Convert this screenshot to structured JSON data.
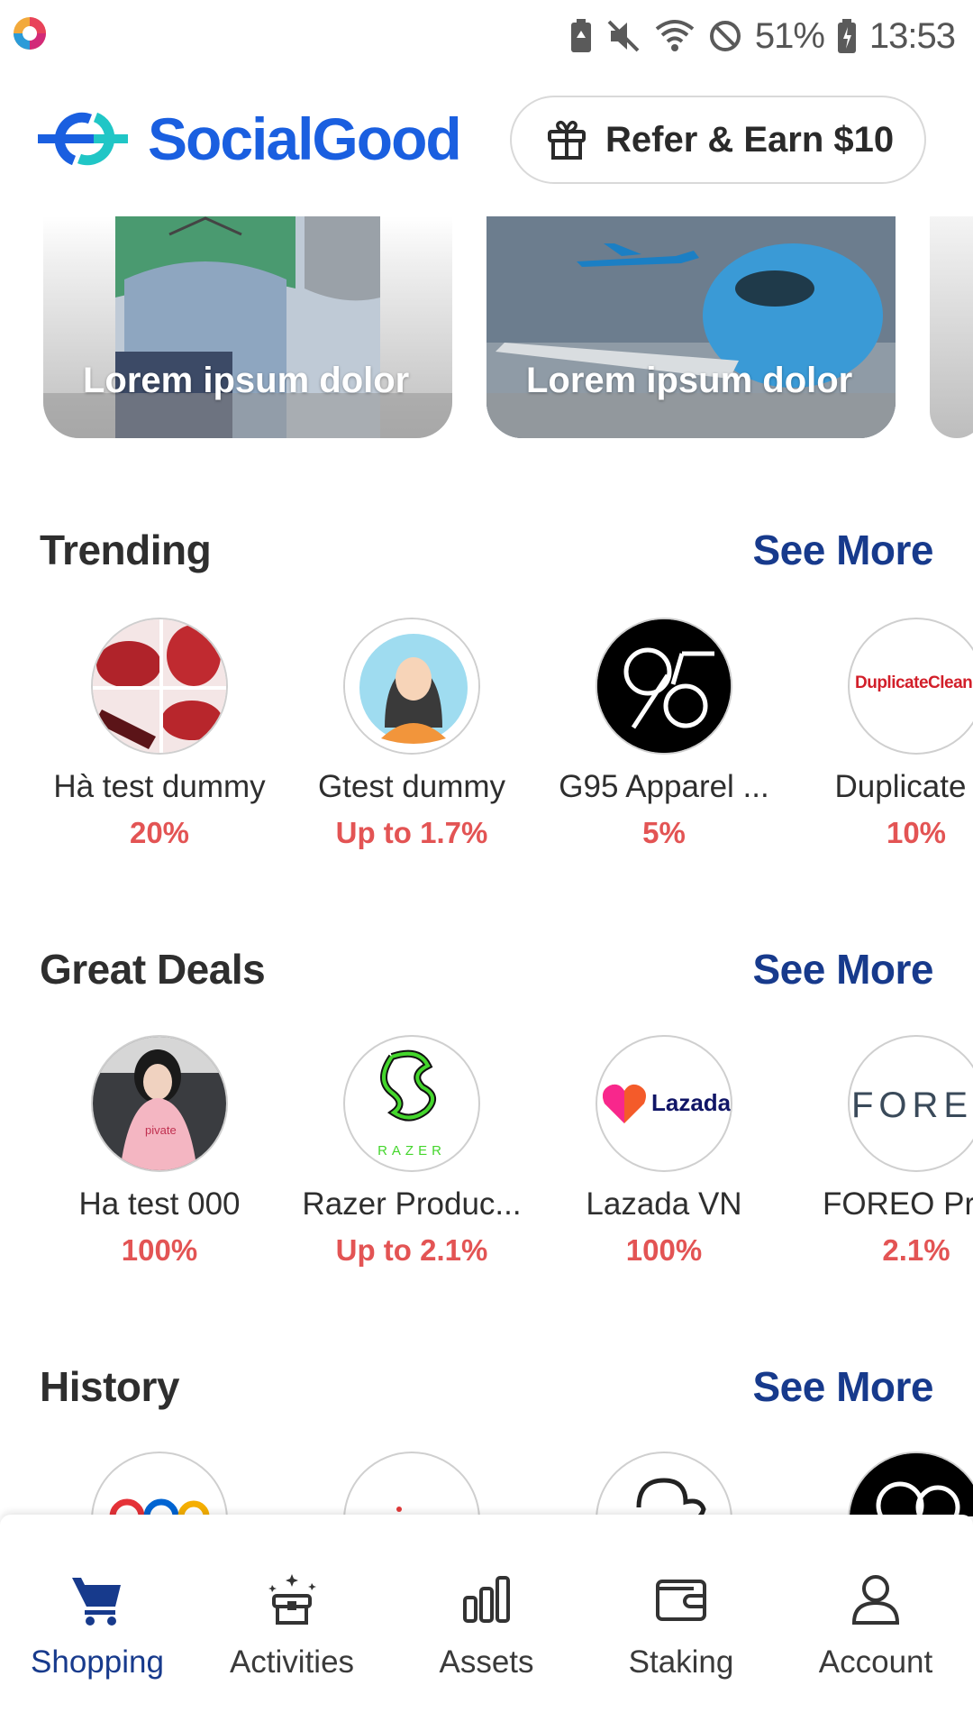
{
  "status_bar": {
    "battery": "51%",
    "time": "13:53"
  },
  "header": {
    "brand": "SocialGood",
    "refer_label": "Refer & Earn $10"
  },
  "banners": [
    {
      "title": "Lorem ipsum dolor"
    },
    {
      "title": "Lorem ipsum dolor"
    }
  ],
  "sections": {
    "trending": {
      "title": "Trending",
      "see_more": "See More",
      "items": [
        {
          "name": "Hà test dummy",
          "rate": "20%"
        },
        {
          "name": "Gtest dummy",
          "rate": "Up to 1.7%"
        },
        {
          "name": "G95 Apparel ...",
          "rate": "5%"
        },
        {
          "name": "Duplicate C",
          "rate": "10%",
          "logo_text": "DuplicateCleaner"
        }
      ]
    },
    "great_deals": {
      "title": "Great Deals",
      "see_more": "See More",
      "items": [
        {
          "name": "Ha test 000",
          "rate": "100%",
          "logo_text": "pivate"
        },
        {
          "name": "Razer Produc...",
          "rate": "Up to 2.1%",
          "logo_text": "RAZER"
        },
        {
          "name": "Lazada VN",
          "rate": "100%",
          "logo_text": "Lazada"
        },
        {
          "name": "FOREO Prod",
          "rate": "2.1%",
          "logo_text": "FOREO"
        }
      ]
    },
    "history": {
      "title": "History",
      "see_more": "See More"
    }
  },
  "bottom_nav": [
    {
      "label": "Shopping",
      "icon": "cart-icon",
      "active": true
    },
    {
      "label": "Activities",
      "icon": "gift-box-icon"
    },
    {
      "label": "Assets",
      "icon": "bar-chart-icon"
    },
    {
      "label": "Staking",
      "icon": "wallet-icon"
    },
    {
      "label": "Account",
      "icon": "person-icon"
    }
  ],
  "colors": {
    "brand_blue": "#1a5fe0",
    "link_blue": "#173a8c",
    "rate_red": "#e35454"
  }
}
